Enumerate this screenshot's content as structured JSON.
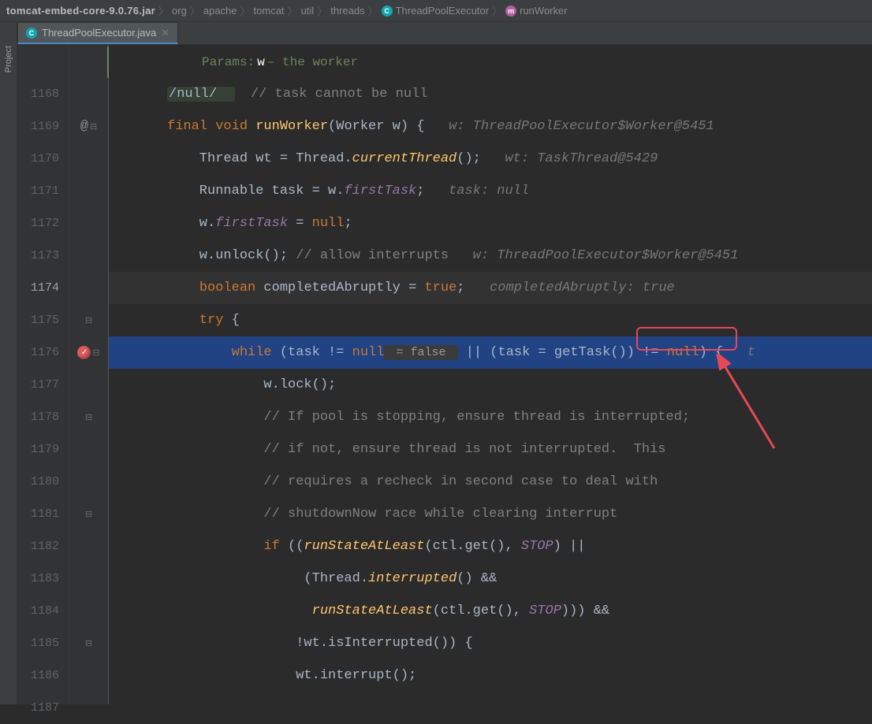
{
  "breadcrumb": {
    "jar": "tomcat-embed-core-9.0.76.jar",
    "path": [
      "org",
      "apache",
      "tomcat",
      "util",
      "threads"
    ],
    "class": "ThreadPoolExecutor",
    "method": "runWorker"
  },
  "sidebar": {
    "project_label": "Project"
  },
  "tab": {
    "filename": "ThreadPoolExecutor.java"
  },
  "param_hint": {
    "label": "Params:",
    "name": "w",
    "desc": " – the worker"
  },
  "gutter": {
    "start": 1168,
    "end": 1187,
    "current": 1174,
    "breakpoint": 1176,
    "override_at": 1169
  },
  "code": {
    "l1168": {
      "pre": "/null/  ",
      "cmt": "// task cannot be null"
    },
    "l1169": {
      "kw1": "final void ",
      "m": "runWorker",
      "sig": "(Worker w) {",
      "hint": "   w: ThreadPoolExecutor$Worker@5451"
    },
    "l1170": {
      "t1": "    Thread wt = Thread.",
      "m": "currentThread",
      "t2": "();",
      "hint": "   wt: TaskThread@5429"
    },
    "l1171": {
      "t1": "    Runnable task = w.",
      "f": "firstTask",
      "t2": ";",
      "hint": "   task: null"
    },
    "l1172": {
      "t1": "    w.",
      "f": "firstTask",
      "t2": " = ",
      "kw": "null",
      "t3": ";"
    },
    "l1173": {
      "t1": "    w.unlock(); ",
      "cmt": "// allow interrupts",
      "hint": "   w: ThreadPoolExecutor$Worker@5451"
    },
    "l1174": {
      "t1": "    ",
      "kw": "boolean",
      "t2": " completedAbruptly = ",
      "kw2": "true",
      "t3": ";",
      "hint": "   completedAbruptly: true"
    },
    "l1175": {
      "t1": "    ",
      "kw": "try",
      "t2": " {"
    },
    "l1176": {
      "t1": "        ",
      "kw": "while",
      "t2": " (task != ",
      "nu": "null",
      "ff": " = false ",
      "t3": " || (task = getTask()) != ",
      "nu2": "null",
      "t4": ") {   ",
      "hint": "t"
    },
    "l1177": {
      "t1": "            w.lock();"
    },
    "l1178": {
      "t1": "            ",
      "cmt": "// If pool is stopping, ensure thread is interrupted;"
    },
    "l1179": {
      "t1": "            ",
      "cmt": "// if not, ensure thread is not interrupted.  This"
    },
    "l1180": {
      "t1": "            ",
      "cmt": "// requires a recheck in second case to deal with"
    },
    "l1181": {
      "t1": "            ",
      "cmt": "// shutdownNow race while clearing interrupt"
    },
    "l1182": {
      "t1": "            ",
      "kw": "if",
      "t2": " ((",
      "m": "runStateAtLeast",
      "t3": "(ctl.get(), ",
      "c": "STOP",
      "t4": ") ||"
    },
    "l1183": {
      "t1": "                 (Thread.",
      "m": "interrupted",
      "t2": "() &&"
    },
    "l1184": {
      "t1": "                  ",
      "m": "runStateAtLeast",
      "t2": "(ctl.get(), ",
      "c": "STOP",
      "t3": "))) &&"
    },
    "l1185": {
      "t1": "                !wt.isInterrupted()) {"
    },
    "l1186": {
      "t1": "                wt.interrupt();"
    }
  }
}
